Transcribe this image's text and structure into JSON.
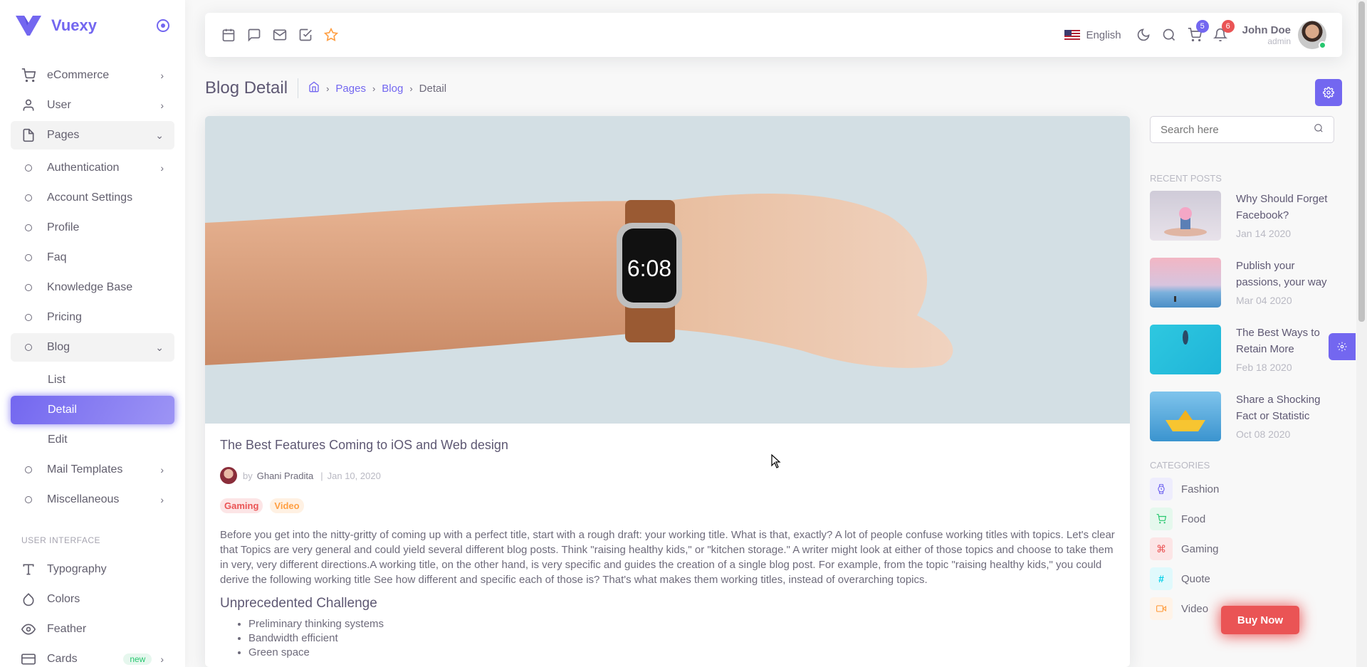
{
  "brand": {
    "name": "Vuexy"
  },
  "sidebar": {
    "items": [
      {
        "label": "eCommerce"
      },
      {
        "label": "User"
      },
      {
        "label": "Pages"
      },
      {
        "label": "Authentication"
      },
      {
        "label": "Account Settings"
      },
      {
        "label": "Profile"
      },
      {
        "label": "Faq"
      },
      {
        "label": "Knowledge Base"
      },
      {
        "label": "Pricing"
      },
      {
        "label": "Blog"
      },
      {
        "label": "List"
      },
      {
        "label": "Detail"
      },
      {
        "label": "Edit"
      },
      {
        "label": "Mail Templates"
      },
      {
        "label": "Miscellaneous"
      }
    ],
    "section_header": "USER INTERFACE",
    "ui_items": [
      {
        "label": "Typography"
      },
      {
        "label": "Colors"
      },
      {
        "label": "Feather"
      },
      {
        "label": "Cards",
        "badge": "new"
      }
    ]
  },
  "navbar": {
    "language": "English",
    "cart_count": "5",
    "notif_count": "6",
    "user_name": "John Doe",
    "user_role": "admin"
  },
  "header": {
    "title": "Blog Detail",
    "breadcrumbs": [
      "Pages",
      "Blog",
      "Detail"
    ]
  },
  "article": {
    "title": "The Best Features Coming to iOS and Web design",
    "by": "by",
    "author": "Ghani Pradita",
    "date": "Jan 10, 2020",
    "tags": [
      "Gaming",
      "Video"
    ],
    "body": "Before you get into the nitty-gritty of coming up with a perfect title, start with a rough draft: your working title. What is that, exactly? A lot of people confuse working titles with topics. Let's clear that Topics are very general and could yield several different blog posts. Think \"raising healthy kids,\" or \"kitchen storage.\" A writer might look at either of those topics and choose to take them in very, very different directions.A working title, on the other hand, is very specific and guides the creation of a single blog post. For example, from the topic \"raising healthy kids,\" you could derive the following working title See how different and specific each of those is? That's what makes them working titles, instead of overarching topics.",
    "subheading": "Unprecedented Challenge",
    "bullets": [
      "Preliminary thinking systems",
      "Bandwidth efficient",
      "Green space"
    ],
    "hero_watch_time": "6:08"
  },
  "right_sidebar": {
    "search_placeholder": "Search here",
    "recent_title": "RECENT POSTS",
    "recent_posts": [
      {
        "title": "Why Should Forget Facebook?",
        "date": "Jan 14 2020"
      },
      {
        "title": "Publish your passions, your way",
        "date": "Mar 04 2020"
      },
      {
        "title": "The Best Ways to Retain More",
        "date": "Feb 18 2020"
      },
      {
        "title": "Share a Shocking Fact or Statistic",
        "date": "Oct 08 2020"
      }
    ],
    "categories_title": "CATEGORIES",
    "categories": [
      {
        "name": "Fashion",
        "color": "#7367f0"
      },
      {
        "name": "Food",
        "color": "#28c76f"
      },
      {
        "name": "Gaming",
        "color": "#ea5455"
      },
      {
        "name": "Quote",
        "color": "#00cfe8"
      },
      {
        "name": "Video",
        "color": "#ff9f43"
      }
    ]
  },
  "buy_now": "Buy Now",
  "colors": {
    "primary": "#7367f0",
    "danger": "#ea5455",
    "success": "#28c76f",
    "warning": "#ff9f43",
    "info": "#00cfe8"
  }
}
